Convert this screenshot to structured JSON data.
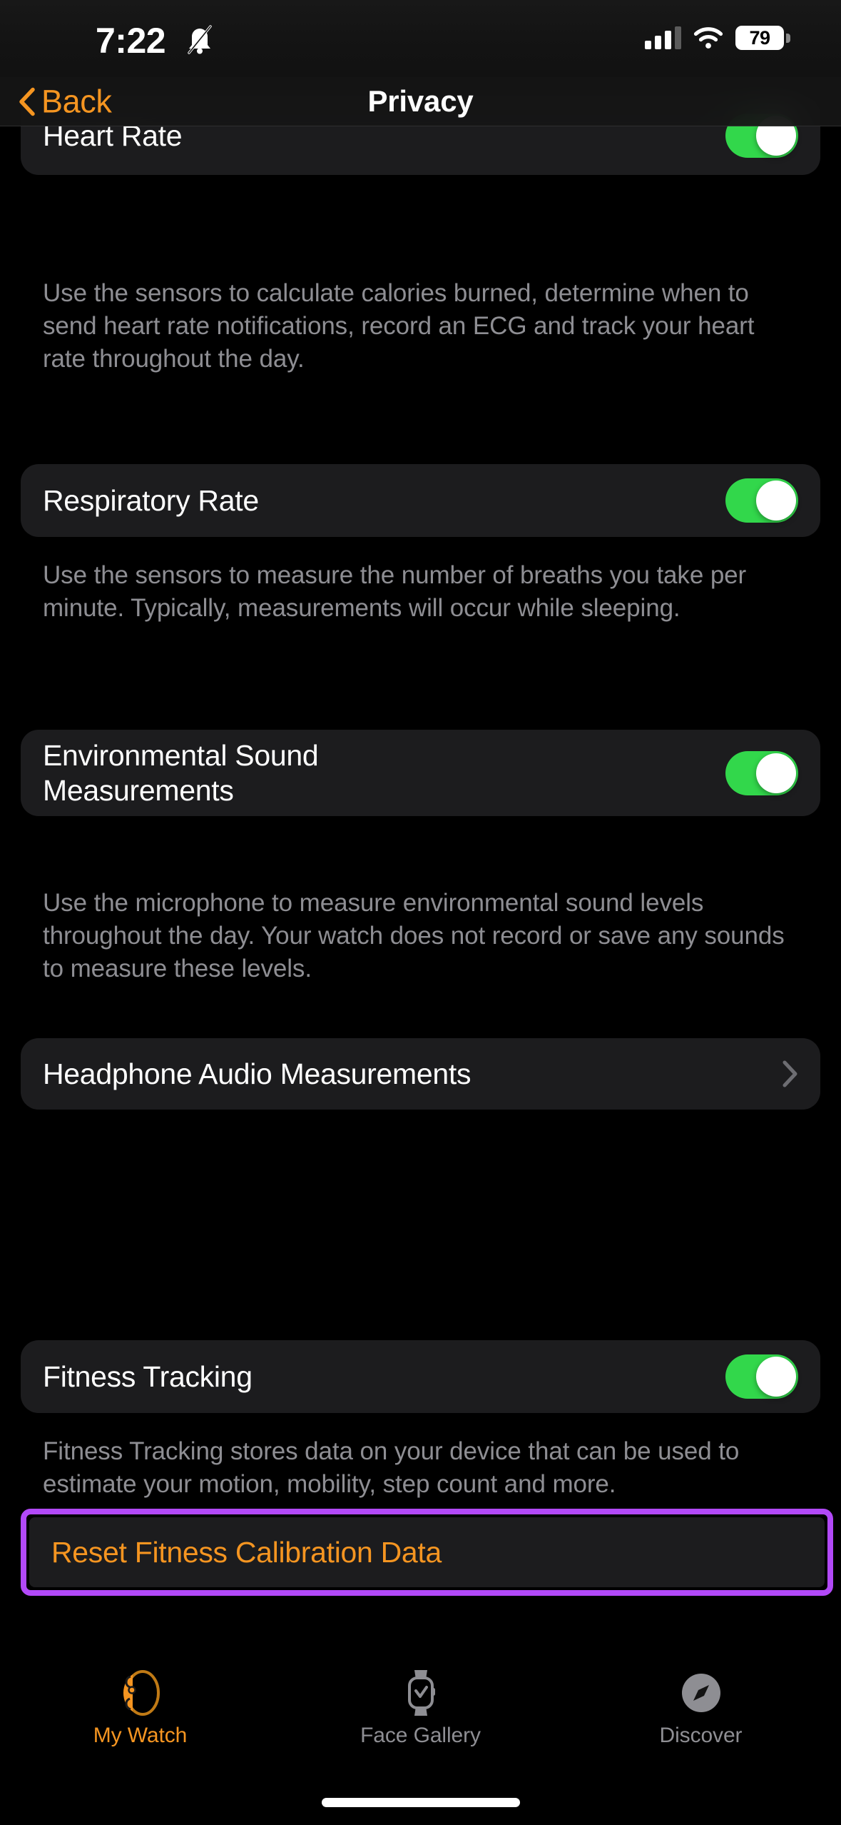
{
  "status_bar": {
    "time": "7:22",
    "silent_icon": "bell-slash-icon",
    "cellular_icon": "cellular-signal-icon",
    "wifi_icon": "wifi-icon",
    "battery_percent": "79"
  },
  "nav": {
    "back_label": "Back",
    "title": "Privacy"
  },
  "colors": {
    "accent_orange": "#f59521",
    "toggle_green": "#32d74b",
    "highlight_purple": "#b249f8",
    "card_background": "#1c1c1e",
    "secondary_text": "#8e8e93"
  },
  "sections": [
    {
      "id": "heart-rate",
      "title": "Heart Rate",
      "control": "toggle",
      "toggle_on": true,
      "description": "Use the sensors to calculate calories burned, determine when to send heart rate notifications, record an ECG and track your heart rate throughout the day."
    },
    {
      "id": "respiratory-rate",
      "title": "Respiratory Rate",
      "control": "toggle",
      "toggle_on": true,
      "description": "Use the sensors to measure the number of breaths you take per minute. Typically, measurements will occur while sleeping."
    },
    {
      "id": "environmental-sound-measurements",
      "title": "Environmental Sound Measurements",
      "control": "toggle",
      "toggle_on": true,
      "description": "Use the microphone to measure environmental sound levels throughout the day. Your watch does not record or save any sounds to measure these levels."
    },
    {
      "id": "headphone-audio-measurements",
      "title": "Headphone Audio Measurements",
      "control": "disclosure",
      "description": ""
    },
    {
      "id": "fitness-tracking",
      "title": "Fitness Tracking",
      "control": "toggle",
      "toggle_on": true,
      "description": "Fitness Tracking stores data on your device that can be used to estimate your motion, mobility, step count and more."
    }
  ],
  "reset_button": {
    "label": "Reset Fitness Calibration Data",
    "highlighted": true
  },
  "tab_bar": {
    "tabs": [
      {
        "id": "my-watch",
        "label": "My Watch",
        "icon": "watch-side-icon",
        "active": true
      },
      {
        "id": "face-gallery",
        "label": "Face Gallery",
        "icon": "watch-face-icon",
        "active": false
      },
      {
        "id": "discover",
        "label": "Discover",
        "icon": "compass-icon",
        "active": false
      }
    ]
  }
}
